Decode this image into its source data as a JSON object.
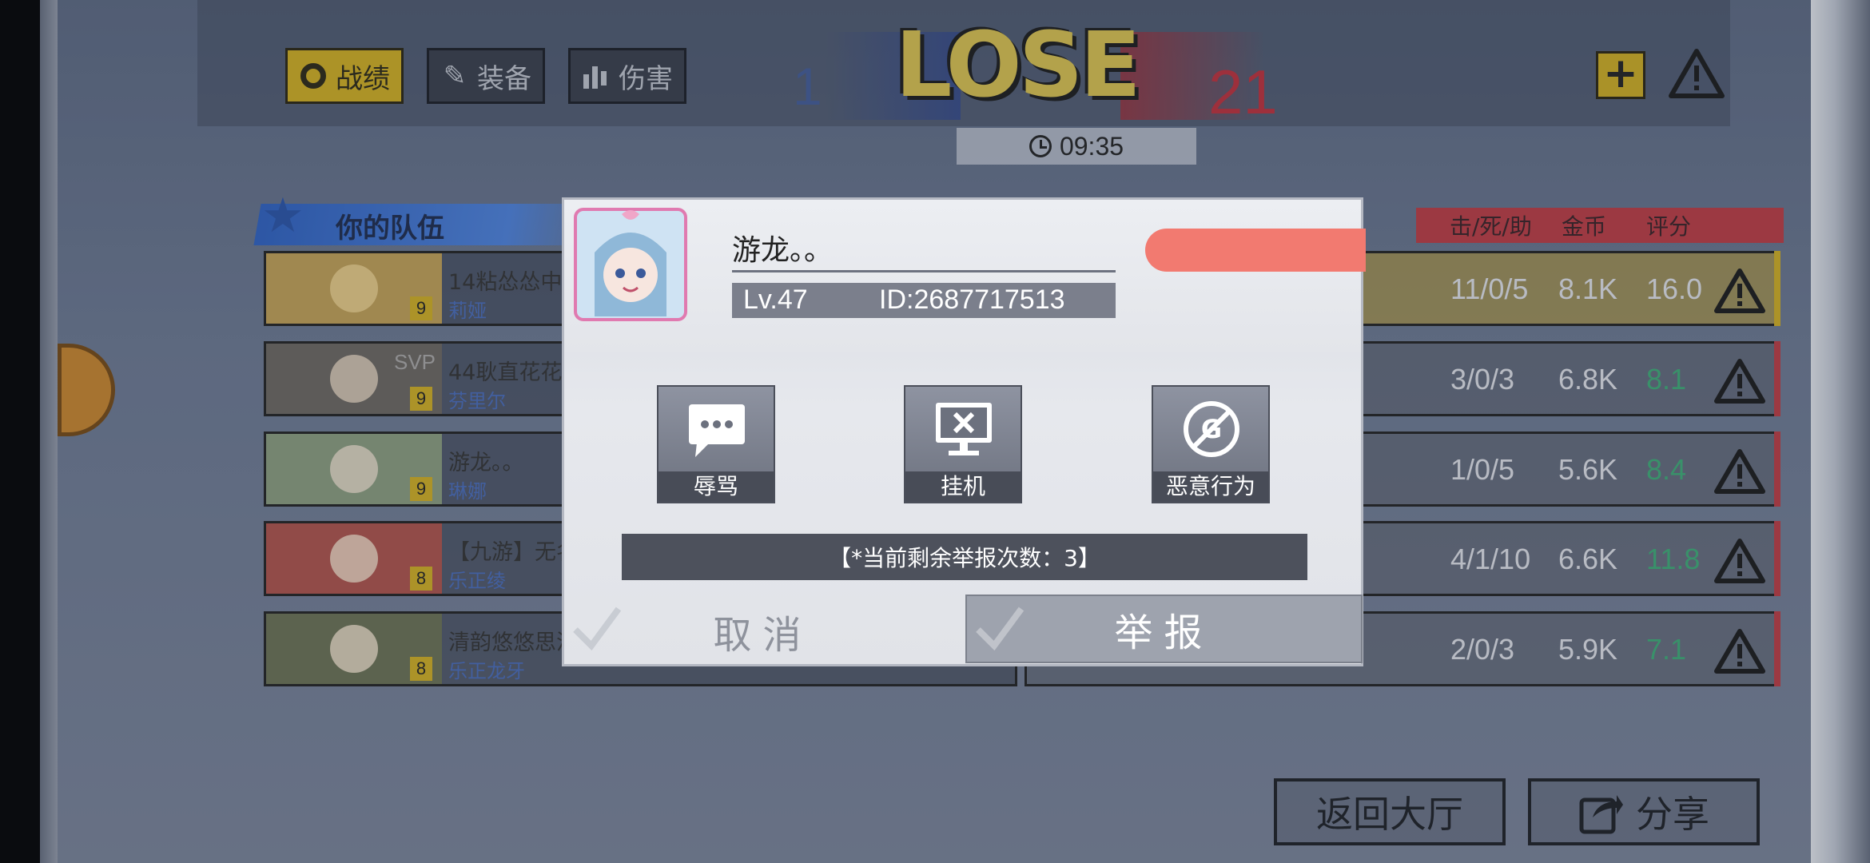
{
  "top_tabs": [
    {
      "label": "战绩",
      "icon": "target-icon",
      "active": true
    },
    {
      "label": "装备",
      "icon": "wrench-icon",
      "active": false
    },
    {
      "label": "伤害",
      "icon": "bar-chart-icon",
      "active": false
    }
  ],
  "match": {
    "result": "LOSE",
    "score_left": "1",
    "score_right": "21",
    "duration": "09:35"
  },
  "team": {
    "title": "你的队伍",
    "players": [
      {
        "name": "14粘怂怂中国风",
        "hero": "莉娅",
        "level": "9",
        "svp": ""
      },
      {
        "name": "44耿直花花广41",
        "hero": "芬里尔",
        "level": "9",
        "svp": "SVP"
      },
      {
        "name": "游龙。。",
        "hero": "琳娜",
        "level": "9",
        "svp": ""
      },
      {
        "name": "【九游】无名",
        "hero": "乐正绫",
        "level": "8",
        "svp": ""
      },
      {
        "name": "清韵悠悠思流年",
        "hero": "乐正龙牙",
        "level": "8",
        "svp": ""
      }
    ]
  },
  "enemy": {
    "columns": [
      "击/死/助",
      "金币",
      "评分"
    ],
    "players": [
      {
        "kda": "11/0/5",
        "gold": "8.1K",
        "rating": "16.0"
      },
      {
        "kda": "3/0/3",
        "gold": "6.8K",
        "rating": "8.1"
      },
      {
        "kda": "1/0/5",
        "gold": "5.6K",
        "rating": "8.4"
      },
      {
        "kda": "4/1/10",
        "gold": "6.6K",
        "rating": "11.8"
      },
      {
        "kda": "2/0/3",
        "gold": "5.9K",
        "rating": "7.1"
      }
    ]
  },
  "bottom": {
    "back_lobby": "返回大厅",
    "share": "分享"
  },
  "dialog": {
    "target_name": "游龙。。",
    "level": "Lv.47",
    "id": "ID:2687717513",
    "options": [
      {
        "label": "辱骂",
        "icon": "chat-bubble-icon"
      },
      {
        "label": "挂机",
        "icon": "monitor-x-icon"
      },
      {
        "label": "恶意行为",
        "icon": "no-gold-icon"
      }
    ],
    "remaining": "【*当前剩余举报次数：3】",
    "cancel": "取消",
    "confirm": "举报"
  },
  "colors": {
    "accent_gold": "#d8b420",
    "enemy_red": "#c33d44",
    "rating_green": "#3fb27a",
    "hp_red": "#f27a70"
  }
}
